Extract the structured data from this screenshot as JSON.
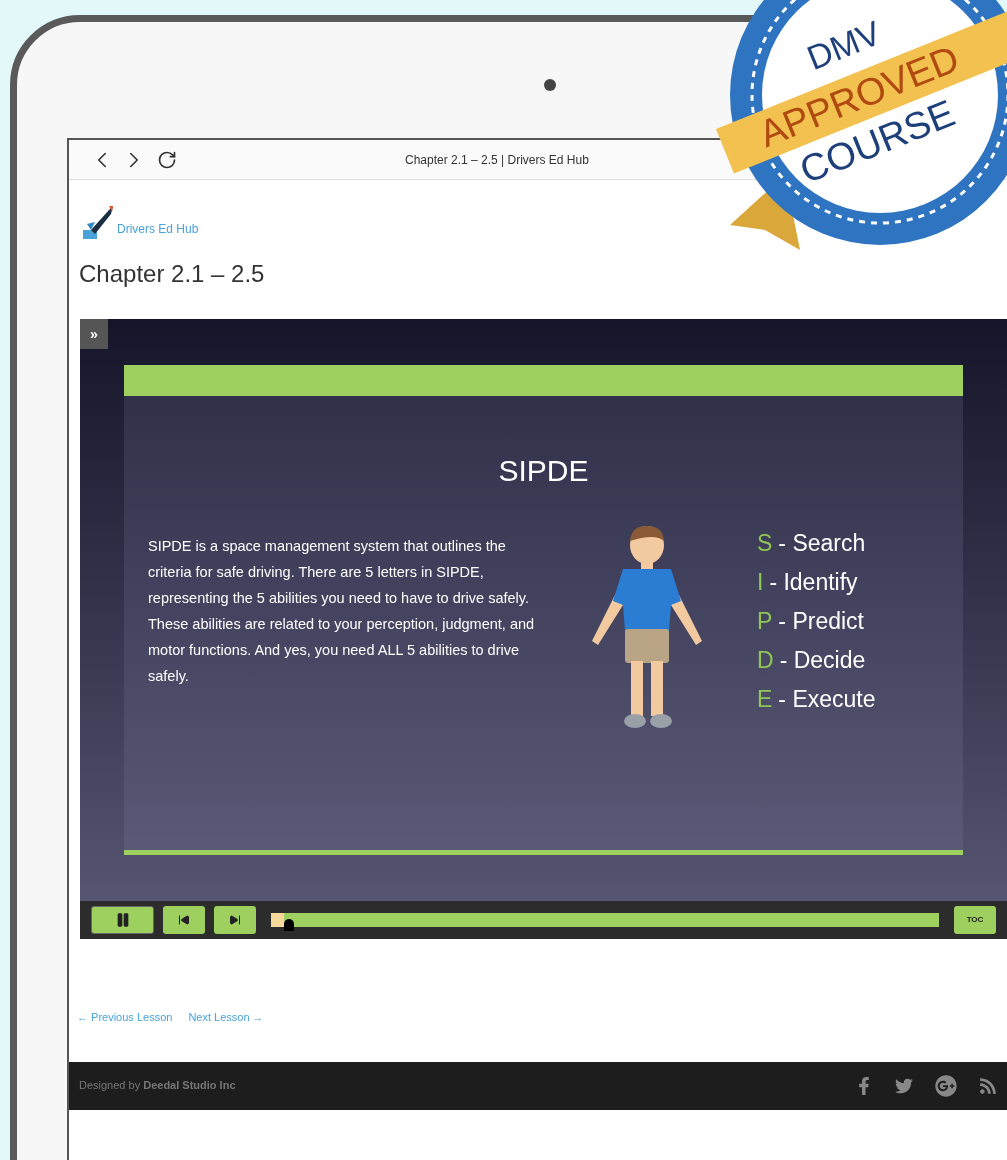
{
  "browser": {
    "title": "Chapter 2.1 – 2.5 | Drivers Ed Hub"
  },
  "site": {
    "logo_text": "Drivers Ed Hub"
  },
  "page_title": "Chapter 2.1 – 2.5",
  "player": {
    "menu_toggle": "»",
    "slide": {
      "title": "SIPDE",
      "body": "SIPDE is a space management system that outlines the criteria for safe driving. There are 5 letters in SIPDE, representing the 5 abilities you need to have to drive safely. These abilities are related to your perception, judgment, and motor functions. And yes, you need ALL 5 abilities to drive safely.",
      "steps": [
        {
          "letter": "S",
          "word": "- Search"
        },
        {
          "letter": "I",
          "word": "- Identify"
        },
        {
          "letter": "P",
          "word": "- Predict"
        },
        {
          "letter": "D",
          "word": "- Decide"
        },
        {
          "letter": "E",
          "word": "- Execute"
        }
      ]
    },
    "controls": {
      "playing": true,
      "level": 0.01,
      "toc": "TOC"
    }
  },
  "lesson_nav": [
    {
      "label": "← Previous Lesson"
    },
    {
      "label": "Next Lesson →"
    }
  ],
  "footer": {
    "credit": "Designed by **Deedal Studio Inc**"
  },
  "badge": {
    "lines": [
      "DMV",
      "APPROVED",
      "COURSE"
    ]
  }
}
